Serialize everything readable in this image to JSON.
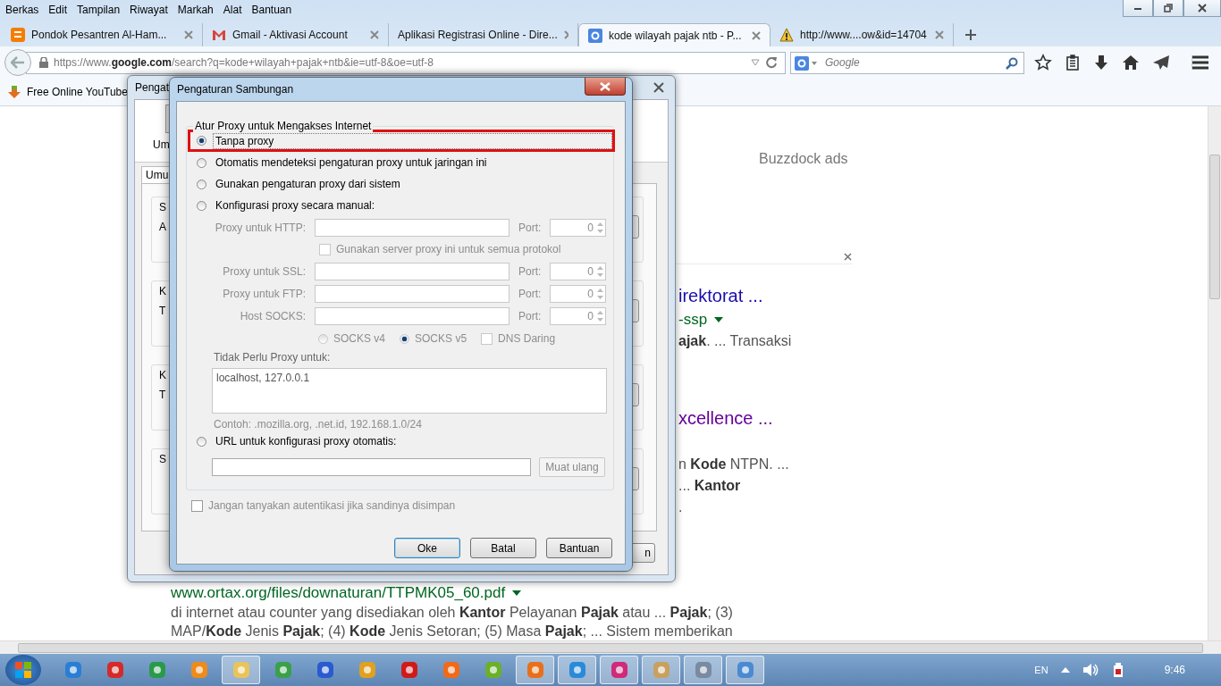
{
  "menu_bar": [
    "Berkas",
    "Edit",
    "Tampilan",
    "Riwayat",
    "Markah",
    "Alat",
    "Bantuan"
  ],
  "tabs": [
    {
      "title": "Pondok Pesantren Al-Ham...",
      "selected": false
    },
    {
      "title": "Gmail - Aktivasi Account",
      "selected": false
    },
    {
      "title": "Aplikasi Registrasi Online - Dire...",
      "selected": false
    },
    {
      "title": "kode wilayah pajak ntb - P...",
      "selected": true
    },
    {
      "title": "http://www....ow&id=14704",
      "selected": false
    }
  ],
  "address_bar": {
    "url": "https://www.**google.com**/search?q=kode+wilayah+pajak+ntb&ie=utf-8&oe=utf-8"
  },
  "search_box": {
    "placeholder": "Google"
  },
  "bookmarks": [
    "Free Online YouTube"
  ],
  "page": {
    "ads_label": "Buzzdock ads",
    "fragments": [
      {
        "kind": "title",
        "text": "irektorat ...",
        "visited": false
      },
      {
        "kind": "url",
        "text": "-ssp"
      },
      {
        "kind": "snippet",
        "text": "**ajak**. ... Transaksi"
      },
      {
        "kind": "title",
        "text": "xcellence ...",
        "visited": true
      },
      {
        "kind": "snippet",
        "text": "n **Kode** NTPN. ..."
      },
      {
        "kind": "snippet",
        "text": "... **Kantor**"
      },
      {
        "kind": "snippet",
        "text": "."
      }
    ],
    "result": {
      "url": "www.ortax.org/files/downaturan/TTPMK05_60.pdf",
      "snippet": [
        "di internet atau counter yang disediakan oleh **Kantor** Pelayanan **Pajak** atau ... **Pajak**; (3)",
        "MAP/**Kode** Jenis **Pajak**; (4) **Kode** Jenis Setoran; (5) Masa **Pajak**; ... Sistem memberikan"
      ]
    }
  },
  "options_window": {
    "title": "Pengat",
    "toolbar_label": "Um",
    "tab": "Umu",
    "groups": [
      {
        "legend": "S",
        "text": "A"
      },
      {
        "legend": "K",
        "text": "T"
      },
      {
        "legend": "K",
        "text": "T"
      },
      {
        "legend": "S"
      }
    ],
    "button": "n"
  },
  "dialog": {
    "title": "Pengaturan Sambungan",
    "group_label": "Atur Proxy untuk Mengakses Internet",
    "modes": [
      {
        "label": "Tanpa proxy",
        "selected": true,
        "highlighted": true
      },
      {
        "label": "Otomatis mendeteksi pengaturan proxy untuk jaringan ini",
        "selected": false,
        "highlighted": false
      },
      {
        "label": "Gunakan pengaturan proxy dari sistem",
        "selected": false,
        "highlighted": false
      },
      {
        "label": "Konfigurasi proxy secara manual:",
        "selected": false,
        "highlighted": false
      }
    ],
    "manual": {
      "disabled": true,
      "proxies": [
        {
          "label": "Proxy untuk HTTP:",
          "port_label": "Port:",
          "port": "0"
        },
        {
          "label": "Proxy untuk SSL:",
          "port_label": "Port:",
          "port": "0"
        },
        {
          "label": "Proxy untuk FTP:",
          "port_label": "Port:",
          "port": "0"
        },
        {
          "label": "Host SOCKS:",
          "port_label": "Port:",
          "port": "0"
        }
      ],
      "share_all": {
        "label": "Gunakan server proxy ini untuk semua protokol",
        "checked": false
      },
      "socks_versions": [
        {
          "label": "SOCKS v4",
          "selected": false
        },
        {
          "label": "SOCKS v5",
          "selected": true
        }
      ],
      "remote_dns": {
        "label": "DNS Daring",
        "checked": false
      },
      "no_proxy_label": "Tidak Perlu Proxy untuk:",
      "no_proxy_value": "localhost, 127.0.0.1",
      "example": "Contoh: .mozilla.org, .net.id, 192.168.1.0/24"
    },
    "auto_config": {
      "label": "URL untuk konfigurasi proxy otomatis:",
      "selected": false,
      "reload_button": "Muat ulang"
    },
    "no_auth_prompt": {
      "label": "Jangan tanyakan autentikasi jika sandinya disimpan",
      "checked": false,
      "disabled": true
    },
    "buttons": [
      {
        "label": "Oke",
        "default": true
      },
      {
        "label": "Batal",
        "default": false
      },
      {
        "label": "Bantuan",
        "default": false
      }
    ]
  },
  "taskbar": {
    "apps": [
      {
        "running": false
      },
      {
        "running": false
      },
      {
        "running": false
      },
      {
        "running": false
      },
      {
        "running": true
      },
      {
        "running": false
      },
      {
        "running": false
      },
      {
        "running": false
      },
      {
        "running": false
      },
      {
        "running": false
      },
      {
        "running": false
      },
      {
        "running": true
      },
      {
        "running": true
      },
      {
        "running": true
      },
      {
        "running": true
      },
      {
        "running": true
      },
      {
        "running": true
      }
    ],
    "language": "EN",
    "clock": "9:46"
  }
}
